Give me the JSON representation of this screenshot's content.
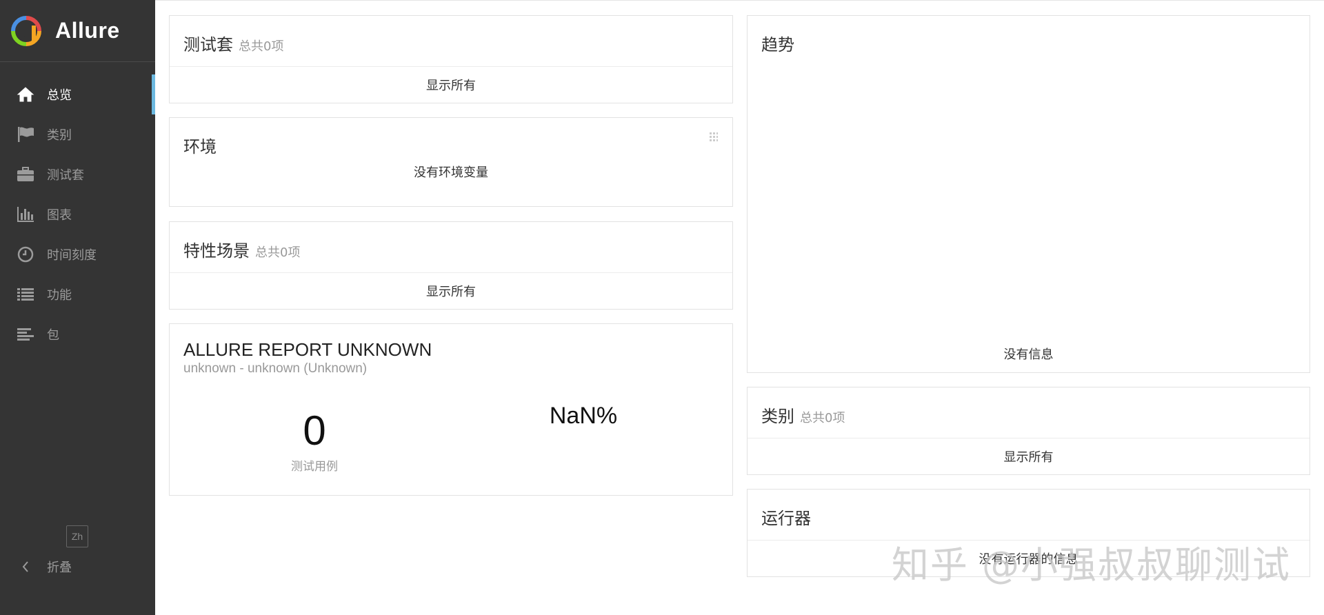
{
  "app": {
    "name": "Allure",
    "accent_color": "#6cb9e0",
    "sidebar_bg": "#343434"
  },
  "sidebar": {
    "items": [
      {
        "label": "总览",
        "icon": "home-icon",
        "active": true
      },
      {
        "label": "类别",
        "icon": "flag-icon",
        "active": false
      },
      {
        "label": "测试套",
        "icon": "briefcase-icon",
        "active": false
      },
      {
        "label": "图表",
        "icon": "bar-chart-icon",
        "active": false
      },
      {
        "label": "时间刻度",
        "icon": "clock-icon",
        "active": false
      },
      {
        "label": "功能",
        "icon": "list-icon",
        "active": false
      },
      {
        "label": "包",
        "icon": "align-left-icon",
        "active": false
      }
    ],
    "language_button": "Zh",
    "collapse_label": "折叠"
  },
  "suites": {
    "title": "测试套",
    "total": "总共0项",
    "show_all": "显示所有"
  },
  "environment": {
    "title": "环境",
    "empty": "没有环境变量"
  },
  "features": {
    "title": "特性场景",
    "total": "总共0项",
    "show_all": "显示所有"
  },
  "report": {
    "title": "ALLURE REPORT UNKNOWN",
    "subtitle": "unknown - unknown (Unknown)",
    "test_count": "0",
    "test_count_label": "测试用例",
    "percent": "NaN%"
  },
  "trend": {
    "title": "趋势",
    "empty": "没有信息"
  },
  "categories": {
    "title": "类别",
    "total": "总共0项",
    "show_all": "显示所有"
  },
  "executors": {
    "title": "运行器",
    "empty": "没有运行器的信息"
  },
  "watermark": "知乎 @小强叔叔聊测试"
}
